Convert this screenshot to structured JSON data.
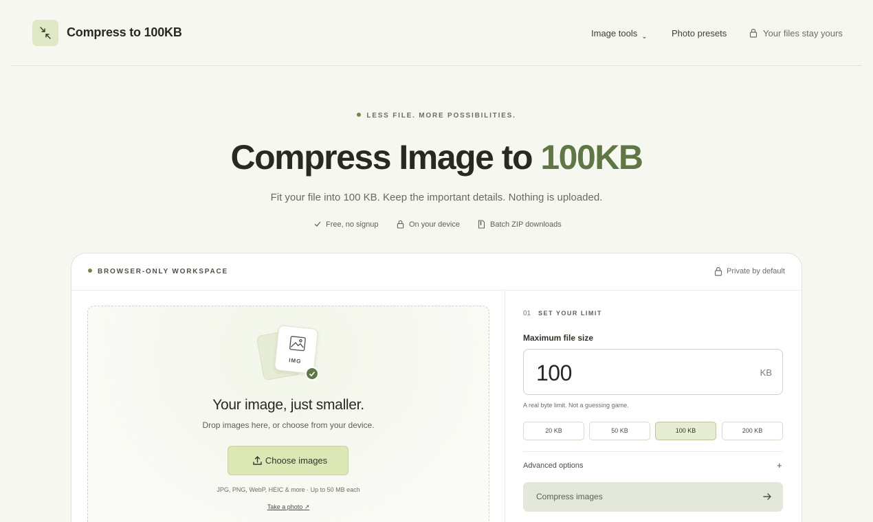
{
  "header": {
    "brand": "Compress to 100KB",
    "nav": {
      "image_tools": "Image tools",
      "photo_presets": "Photo presets",
      "private": "Your files stay yours"
    }
  },
  "hero": {
    "eyebrow": "LESS FILE. MORE POSSIBILITIES.",
    "title_main": "Compress Image to ",
    "title_accent": "100KB",
    "subtitle": "Fit your file into 100 KB. Keep the important details. Nothing is uploaded.",
    "features": [
      "Free, no signup",
      "On your device",
      "Batch ZIP downloads"
    ]
  },
  "workspace": {
    "label": "BROWSER-ONLY WORKSPACE",
    "private": "Private by default",
    "dropzone": {
      "icon_tag": "IMG",
      "title": "Your image, just smaller.",
      "subtitle": "Drop images here, or choose from your device.",
      "choose_button": "Choose images",
      "formats": "JPG, PNG, WebP, HEIC & more · Up to 50 MB each",
      "take_photo": "Take a photo ↗"
    },
    "settings": {
      "step_number": "01",
      "step_label": "SET YOUR LIMIT",
      "field_label": "Maximum file size",
      "value": "100",
      "unit": "KB",
      "hint": "A real byte limit. Not a guessing game.",
      "presets": [
        "20 KB",
        "50 KB",
        "100 KB",
        "200 KB"
      ],
      "active_preset": "100 KB",
      "advanced": "Advanced options",
      "advanced_toggle": "+",
      "compress_button": "Compress images"
    }
  },
  "colors": {
    "accent": "#5f7645",
    "button_primary": "#dbe8b6",
    "background": "#f7f7f2"
  }
}
